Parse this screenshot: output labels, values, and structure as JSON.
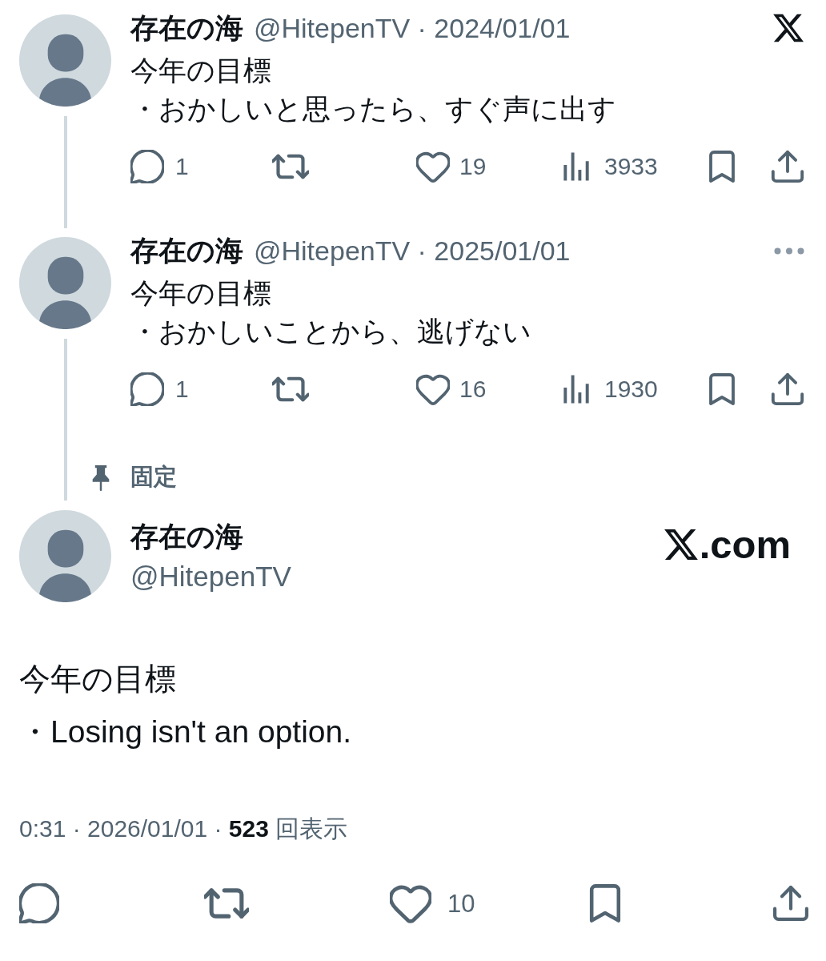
{
  "thread": [
    {
      "kind": "logo",
      "author": "存在の海",
      "byline": "@HitepenTV · 2024/01/01",
      "body": [
        "今年の目標",
        "・おかしいと思ったら、すぐ声に出す"
      ],
      "stats": {
        "replies": "1",
        "likes": "19",
        "views": "3933"
      }
    },
    {
      "kind": "menu",
      "author": "存在の海",
      "byline": "@HitepenTV · 2025/01/01",
      "body": [
        "今年の目標",
        "・おかしいことから、逃げない"
      ],
      "stats": {
        "replies": "1",
        "likes": "16",
        "views": "1930"
      }
    }
  ],
  "pinned": {
    "label": "固定"
  },
  "main_tweet": {
    "author": "存在の海",
    "handle": "@HitepenTV",
    "site_logo_text": ".com",
    "body": [
      "今年の目標",
      "・Losing isn't an option."
    ],
    "meta": "0:31 · 2026/01/01 · **523** 回表示",
    "stats": {
      "likes": "10"
    }
  }
}
